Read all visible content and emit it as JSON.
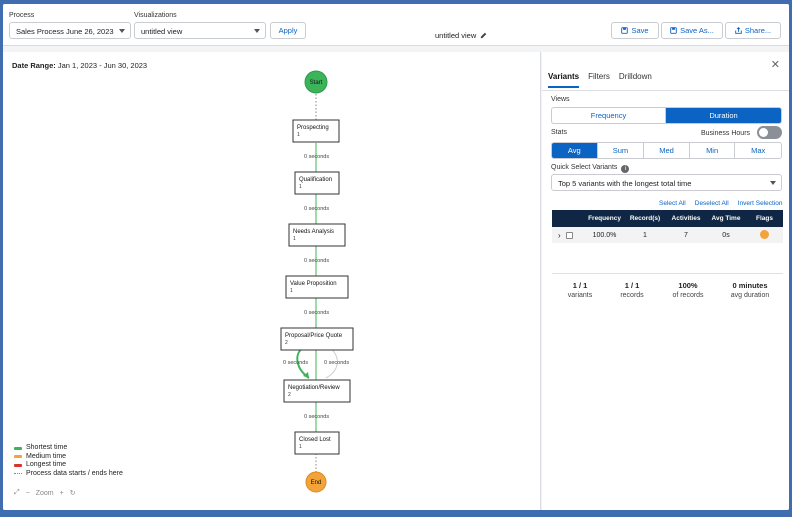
{
  "toolbar": {
    "process_label": "Process",
    "process_value": "Sales Process June 26, 2023",
    "visualizations_label": "Visualizations",
    "visualizations_value": "untitled view",
    "apply_label": "Apply",
    "view_name": "untitled view",
    "save_label": "Save",
    "save_as_label": "Save As...",
    "share_label": "Share..."
  },
  "canvas": {
    "date_range_label": "Date Range:",
    "date_range_value": "Jan 1, 2023 - Jun 30, 2023",
    "start_label": "Start",
    "end_label": "End",
    "steps": [
      {
        "name": "Prospecting",
        "count": "1"
      },
      {
        "name": "Qualification",
        "count": "1"
      },
      {
        "name": "Needs Analysis",
        "count": "1"
      },
      {
        "name": "Value Proposition",
        "count": "1"
      },
      {
        "name": "Proposal/Price Quote",
        "count": "2"
      },
      {
        "name": "Negotiation/Review",
        "count": "2"
      },
      {
        "name": "Closed Lost",
        "count": "1"
      }
    ],
    "edge_labels": [
      "0 seconds",
      "0 seconds",
      "0 seconds",
      "0 seconds",
      "0 seconds",
      "0 seconds",
      "0 seconds",
      "0 seconds"
    ],
    "legend": [
      {
        "label": "Shortest time",
        "color": "#3cb55a"
      },
      {
        "label": "Medium time",
        "color": "#f2a33a"
      },
      {
        "label": "Longest time",
        "color": "#d9342b"
      },
      {
        "label": "Process data starts / ends here",
        "color": "#888888"
      }
    ],
    "zoom_label": "Zoom",
    "colors": {
      "start": "#3cb55a",
      "end": "#f2a33a",
      "loop": "#3cb55a"
    }
  },
  "panel": {
    "tabs": [
      "Variants",
      "Filters",
      "Drilldown"
    ],
    "views_label": "Views",
    "views": [
      "Frequency",
      "Duration"
    ],
    "views_selected": "Duration",
    "stats_label": "Stats",
    "business_hours_label": "Business Hours",
    "stats": [
      "Avg",
      "Sum",
      "Med",
      "Min",
      "Max"
    ],
    "stats_selected": "Avg",
    "quick_select_label": "Quick Select Variants",
    "quick_select_value": "Top 5 variants with the longest total time",
    "select_all": "Select All",
    "deselect_all": "Deselect All",
    "invert_selection": "Invert Selection",
    "table": {
      "headers": [
        "Frequency",
        "Record(s)",
        "Activities",
        "Avg Time",
        "Flags"
      ],
      "rows": [
        {
          "frequency": "100.0%",
          "records": "1",
          "activities": "7",
          "avg_time": "0s",
          "flag_icon": "flag-warning-icon"
        }
      ]
    },
    "summary": [
      {
        "value": "1 / 1",
        "label": "variants"
      },
      {
        "value": "1 / 1",
        "label": "records"
      },
      {
        "value": "100%",
        "label": "of records"
      },
      {
        "value": "0 minutes",
        "label": "avg duration"
      }
    ],
    "accent": "#0b63c4"
  }
}
